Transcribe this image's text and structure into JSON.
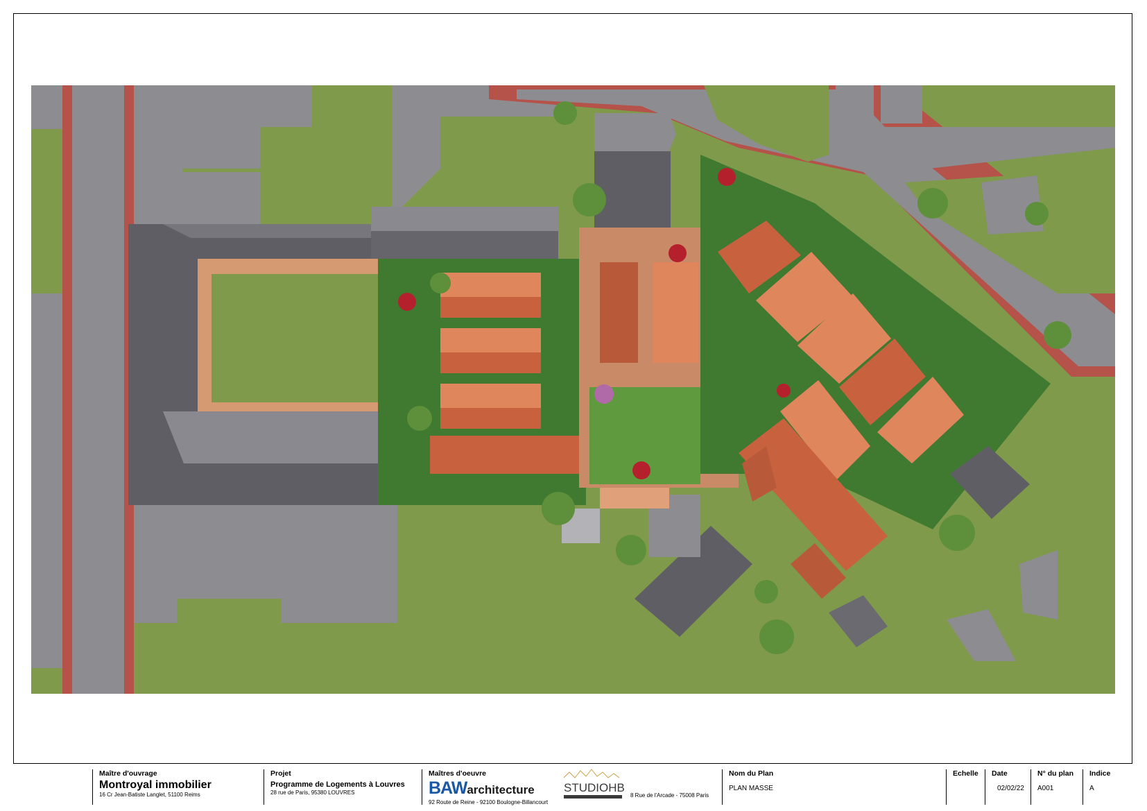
{
  "cartouche": {
    "maitre_ouvrage": {
      "label": "Maître d'ouvrage",
      "name": "Montroyal immobilier",
      "address": "16 Cr Jean-Batiste Langlet, 51100 Reims"
    },
    "projet": {
      "label": "Projet",
      "name": "Programme de Logements à Louvres",
      "address": "28 rue de Paris, 95380 LOUVRES"
    },
    "maitres_oeuvre": {
      "label": "Maîtres d'oeuvre",
      "baw_logo": {
        "main": "BAW",
        "sub": "architecture"
      },
      "baw_address": "92 Route de Reine - 92100 Boulogne-Billancourt",
      "studio_logo": "STUDIOHB",
      "studio_address": "8 Rue de l'Arcade - 75008 Paris"
    },
    "nom_du_plan": {
      "label": "Nom du Plan",
      "value": "PLAN MASSE"
    },
    "echelle": {
      "label": "Echelle",
      "value": ""
    },
    "date": {
      "label": "Date",
      "value": "02/02/22"
    },
    "numero_plan": {
      "label": "N° du plan",
      "value": "A001"
    },
    "indice": {
      "label": "Indice",
      "value": "A"
    }
  },
  "colors": {
    "grass": "#7e9a4a",
    "road": "#8d8c91",
    "sidewalk": "#b5524a",
    "roof_grey": "#6b6a70",
    "roof_tile": "#c8623e",
    "roof_tile_light": "#e0865d",
    "garden": "#3f7a30",
    "path": "#c98a68",
    "baw_blue": "#1a57a5"
  }
}
